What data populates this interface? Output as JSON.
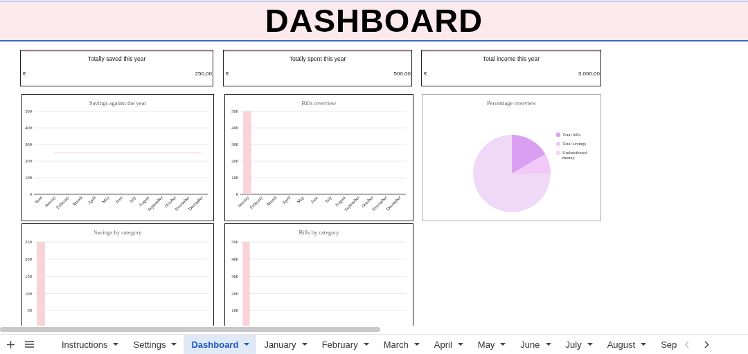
{
  "header": {
    "title": "DASHBOARD"
  },
  "summary_cards": [
    {
      "title": "Totally saved this year",
      "currency": "€",
      "amount": "250,00"
    },
    {
      "title": "Totally spent this year",
      "currency": "€",
      "amount": "500,00"
    },
    {
      "title": "Total income this year",
      "currency": "€",
      "amount": "3.000,00"
    }
  ],
  "charts": [
    {
      "chart_data": {
        "type": "line",
        "title": "Savings against the year",
        "categories": [
          "Start",
          "January",
          "February",
          "March",
          "April",
          "May",
          "June",
          "July",
          "August",
          "September",
          "October",
          "November",
          "December"
        ],
        "series": [
          {
            "color": "#f6cdd2",
            "values": [
              null,
              250,
              250,
              250,
              250,
              250,
              250,
              250,
              250,
              250,
              250,
              250,
              250
            ]
          }
        ],
        "ylim": [
          0,
          500
        ],
        "yticks": [
          0,
          100,
          200,
          300,
          400,
          500
        ],
        "grid": true
      }
    },
    {
      "chart_data": {
        "type": "bar",
        "title": "Bills overview",
        "categories": [
          "January",
          "February",
          "March",
          "April",
          "May",
          "June",
          "July",
          "August",
          "September",
          "October",
          "November",
          "December"
        ],
        "series": [
          {
            "color": "#f8d4d9",
            "values": [
              500,
              0,
              0,
              0,
              0,
              0,
              0,
              0,
              0,
              0,
              0,
              0
            ]
          }
        ],
        "ylim": [
          0,
          500
        ],
        "yticks": [
          0,
          100,
          200,
          300,
          400,
          500
        ],
        "grid": true
      }
    },
    {
      "chart_data": {
        "type": "pie",
        "title": "Percentage overview",
        "categories": [
          "Total bills",
          "Total savings",
          "Undistributed money"
        ],
        "series": [
          {
            "values": [
              16.7,
              8.3,
              75
            ]
          }
        ],
        "colors": [
          "#d9a0f2",
          "#f2c8f9",
          "#f0d9f6"
        ],
        "legend": true
      }
    },
    {
      "chart_data": {
        "type": "bar",
        "title": "Savings by category",
        "series": [
          {
            "color": "#f8d4d9",
            "values": [
              250
            ]
          }
        ],
        "ylim": [
          0,
          250
        ],
        "yticks": [
          50,
          100,
          150,
          200,
          250
        ],
        "grid": true
      }
    },
    {
      "chart_data": {
        "type": "bar",
        "title": "Bills by category",
        "series": [
          {
            "color": "#f8d4d9",
            "values": [
              500
            ]
          }
        ],
        "ylim": [
          0,
          500
        ],
        "yticks": [
          100,
          200,
          300,
          400,
          500
        ],
        "grid": true
      }
    }
  ],
  "sheet_tabs": [
    {
      "label": "Instructions",
      "selected": false,
      "kind": "tab"
    },
    {
      "label": "Settings",
      "selected": false,
      "kind": "tab"
    },
    {
      "label": "Dashboard",
      "selected": true,
      "kind": "tab"
    },
    {
      "label": "January",
      "selected": false,
      "kind": "tab"
    },
    {
      "label": "February",
      "selected": false,
      "kind": "tab"
    },
    {
      "label": "March",
      "selected": false,
      "kind": "tab"
    },
    {
      "label": "April",
      "selected": false,
      "kind": "tab"
    },
    {
      "label": "May",
      "selected": false,
      "kind": "tab"
    },
    {
      "label": "June",
      "selected": false,
      "kind": "tab"
    },
    {
      "label": "July",
      "selected": false,
      "kind": "tab"
    },
    {
      "label": "August",
      "selected": false,
      "kind": "tab"
    },
    {
      "label": "Sep",
      "selected": false,
      "kind": "clipped"
    }
  ]
}
